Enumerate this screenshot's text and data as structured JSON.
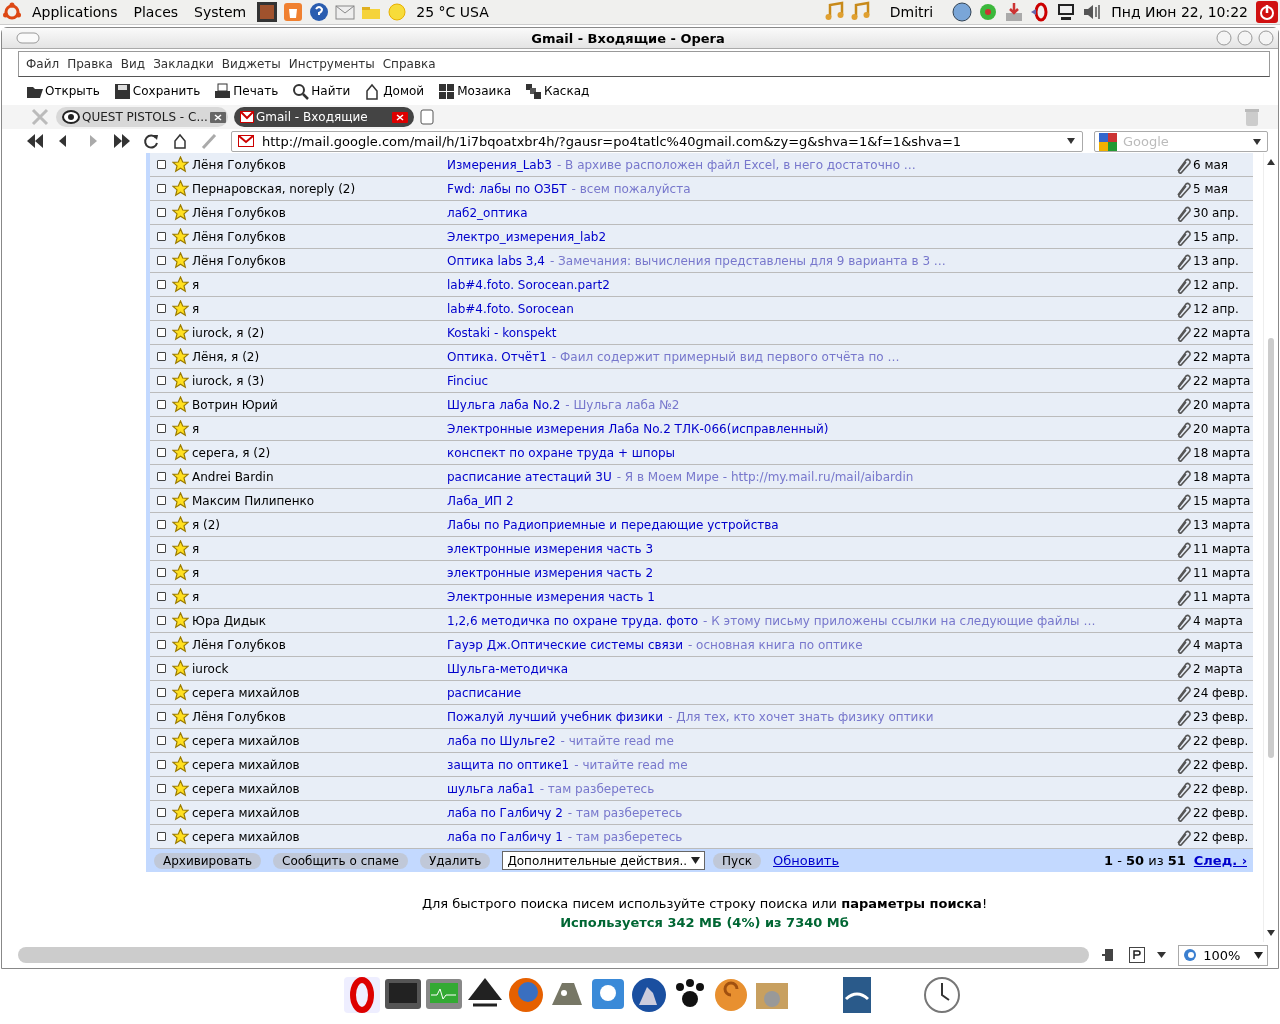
{
  "panel": {
    "menus": [
      {
        "label": "Applications"
      },
      {
        "label": "Places"
      },
      {
        "label": "System"
      }
    ],
    "weather": "25 °C USA",
    "user": "Dmitri",
    "clock": "Пнд Июн 22, 10:22"
  },
  "window": {
    "title": "Gmail - Входящие - Opera"
  },
  "menu": [
    "Файл",
    "Правка",
    "Вид",
    "Закладки",
    "Виджеты",
    "Инструменты",
    "Справка"
  ],
  "toolbar": [
    "Открыть",
    "Сохранить",
    "Печать",
    "Найти",
    "Домой",
    "Мозаика",
    "Каскад"
  ],
  "tabs": [
    {
      "label": "QUEST PISTOLS - С...",
      "selected": false
    },
    {
      "label": "Gmail - Входящие",
      "selected": true
    }
  ],
  "address": {
    "url": "http://mail.google.com/mail/h/1i7bqoatxbr4h/?gausr=po4tatlc%40gmail.com&zy=g&shva=1&f=1&shva=1"
  },
  "search": {
    "placeholder": "Google"
  },
  "rows": [
    {
      "sender": "Лёня Голубков",
      "subject": "Измерения_Lab3",
      "snippet": "- В архиве расположен файл Excel, в него достаточно …",
      "date": "6 мая",
      "checked": false,
      "starred": true
    },
    {
      "sender": "Пернаровская, noreply (2)",
      "subject": "Fwd: лабы по ОЗБТ",
      "snippet": "- всем пожалуйста",
      "date": "5 мая",
      "checked": false,
      "starred": true
    },
    {
      "sender": "Лёня Голубков",
      "subject": "лаб2_оптика",
      "date": "30 апр.",
      "checked": false,
      "starred": true
    },
    {
      "sender": "Лёня Голубков",
      "subject": "Электро_измерения_lab2",
      "date": "15 апр.",
      "checked": false,
      "starred": true
    },
    {
      "sender": "Лёня Голубков",
      "subject": "Оптика labs 3,4",
      "snippet": "- Замечания: вычисления представлены для 9 варианта в 3 …",
      "date": "13 апр.",
      "checked": false,
      "starred": true
    },
    {
      "sender": "я",
      "subject": "lab#4.foto. Sorocean.part2",
      "date": "12 апр.",
      "checked": false,
      "starred": true
    },
    {
      "sender": "я",
      "subject": "lab#4.foto. Sorocean",
      "date": "12 апр.",
      "checked": false,
      "starred": true
    },
    {
      "sender": "iurock, я (2)",
      "subject": "Kostaki - konspekt",
      "date": "22 марта",
      "checked": false,
      "starred": true
    },
    {
      "sender": "Лёня, я (2)",
      "subject": "Оптика. Отчёт1",
      "snippet": "- Фаил содержит примерный вид первого отчёта по …",
      "date": "22 марта",
      "checked": false,
      "starred": true
    },
    {
      "sender": "iurock, я (3)",
      "subject": "Finciuc",
      "date": "22 марта",
      "checked": false,
      "starred": true
    },
    {
      "sender": "Вотрин Юрий",
      "subject": "Шульга лаба No.2",
      "snippet": "- Шульга лаба №2",
      "date": "20 марта",
      "checked": false,
      "starred": true
    },
    {
      "sender": "я",
      "subject": "Электронные измерения Лаба No.2 ТЛК-066(исправленный)",
      "date": "20 марта",
      "checked": false,
      "starred": true
    },
    {
      "sender": "серега, я (2)",
      "subject": "конспект по охране труда + шпоры",
      "date": "18 марта",
      "checked": false,
      "starred": true
    },
    {
      "sender": "Andrei Bardin",
      "subject": "расписание атестаций 3U",
      "snippet": "- Я в Моем Мире - http://my.mail.ru/mail/aibardin",
      "date": "18 марта",
      "checked": false,
      "starred": true
    },
    {
      "sender": "Максим Пилипенко",
      "subject": "Лаба_ИП 2",
      "date": "15 марта",
      "checked": false,
      "starred": true
    },
    {
      "sender": "я (2)",
      "subject": "Лабы по Радиоприемные и передающие устройства",
      "date": "13 марта",
      "checked": false,
      "starred": true
    },
    {
      "sender": "я",
      "subject": "электронные измерения часть 3",
      "date": "11 марта",
      "checked": false,
      "starred": true
    },
    {
      "sender": "я",
      "subject": "электронные измерения часть 2",
      "date": "11 марта",
      "checked": false,
      "starred": true
    },
    {
      "sender": "я",
      "subject": "Электронные измерения часть 1",
      "date": "11 марта",
      "checked": false,
      "starred": true
    },
    {
      "sender": "Юра Дидык",
      "subject": "1,2,6 методичка по охране труда. фото",
      "snippet": "- К этому письму приложены ссылки на следующие файлы …",
      "date": "4 марта",
      "checked": false,
      "starred": true
    },
    {
      "sender": "Лёня Голубков",
      "subject": "Гауэр Дж.Оптические системы связи",
      "snippet": "- основная книга по оптике",
      "date": "4 марта",
      "checked": false,
      "starred": true
    },
    {
      "sender": "iurock",
      "subject": "Шульга-методичка",
      "date": "2 марта",
      "checked": false,
      "starred": true
    },
    {
      "sender": "серега михайлов",
      "subject": "расписание",
      "date": "24 февр.",
      "checked": false,
      "starred": true
    },
    {
      "sender": "Лёня Голубков",
      "subject": "Пожалуй лучший учебник физики",
      "snippet": "- Для тех, кто хочет знать физику оптики",
      "date": "23 февр.",
      "checked": false,
      "starred": true
    },
    {
      "sender": "серега михайлов",
      "subject": "лаба по Шульге2",
      "snippet": "- читайте read me",
      "date": "22 февр.",
      "checked": false,
      "starred": true
    },
    {
      "sender": "серега михайлов",
      "subject": "защита по оптике1",
      "snippet": "- читайте read me",
      "date": "22 февр.",
      "checked": false,
      "starred": true
    },
    {
      "sender": "серега михайлов",
      "subject": "шульга лаба1",
      "snippet": "- там разберетесь",
      "date": "22 февр.",
      "checked": false,
      "starred": true
    },
    {
      "sender": "серега михайлов",
      "subject": "лаба по Галбичу 2",
      "snippet": "- там разберетесь",
      "date": "22 февр.",
      "checked": false,
      "starred": true
    },
    {
      "sender": "серега михайлов",
      "subject": "лаба по Галбичу 1",
      "snippet": "- там разберетесь",
      "date": "22 февр.",
      "checked": false,
      "starred": true
    }
  ],
  "actions": {
    "buttons": [
      "Архивировать",
      "Сообщить о спаме",
      "Удалить"
    ],
    "more": "Дополнительные действия..",
    "go": "Пуск",
    "refresh": "Обновить",
    "pager": "**1** - **50** из **51**",
    "next": "След. ›"
  },
  "footer": {
    "tip": "Для быстрого поиска писем используйте строку поиска или **параметры  поиска**!",
    "storage": "Используется 342 МБ (4%) из 7340 Мб"
  },
  "status": {
    "zoom": "100%"
  }
}
